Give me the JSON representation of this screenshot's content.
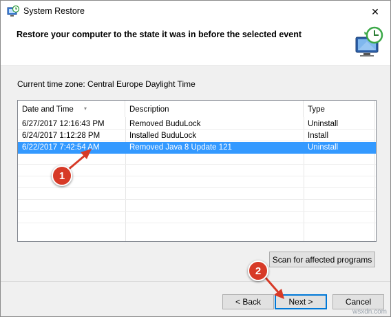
{
  "window": {
    "title": "System Restore",
    "close_glyph": "✕"
  },
  "header": {
    "title": "Restore your computer to the state it was in before the selected event"
  },
  "timezone_text": "Current time zone: Central Europe Daylight Time",
  "table": {
    "columns": [
      "Date and Time",
      "Description",
      "Type"
    ],
    "sort_indicator": "▾",
    "rows": [
      {
        "date": "6/27/2017 12:16:43 PM",
        "description": "Removed BuduLock",
        "type": "Uninstall",
        "selected": false
      },
      {
        "date": "6/24/2017 1:12:28 PM",
        "description": "Installed BuduLock",
        "type": "Install",
        "selected": false
      },
      {
        "date": "6/22/2017 7:42:54 AM",
        "description": "Removed Java 8 Update 121",
        "type": "Uninstall",
        "selected": true
      }
    ]
  },
  "buttons": {
    "scan": "Scan for affected programs",
    "back": "< Back",
    "next": "Next >",
    "cancel": "Cancel"
  },
  "annotations": {
    "badge_1": "1",
    "badge_2": "2",
    "color": "#d73a27"
  },
  "selection_color": "#3399ff",
  "watermark": "wsxdn.com"
}
